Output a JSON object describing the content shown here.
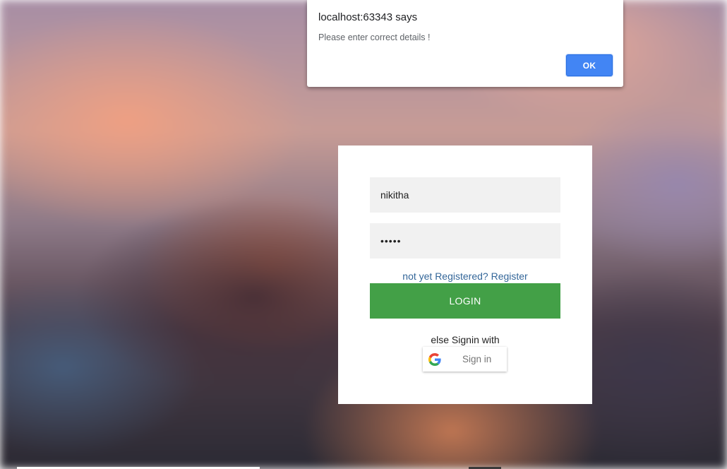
{
  "alert": {
    "title": "localhost:63343 says",
    "message": "Please enter correct details !",
    "ok_label": "OK"
  },
  "login": {
    "username_value": "nikitha",
    "password_value": "•••••",
    "register_link": "not yet Registered? Register",
    "login_label": "LOGIN",
    "else_text": "else Signin with",
    "google_label": "Sign in",
    "google_icon": "google-g-icon"
  },
  "colors": {
    "login_button": "#43a047",
    "ok_button": "#4285f4",
    "link": "#336699"
  }
}
